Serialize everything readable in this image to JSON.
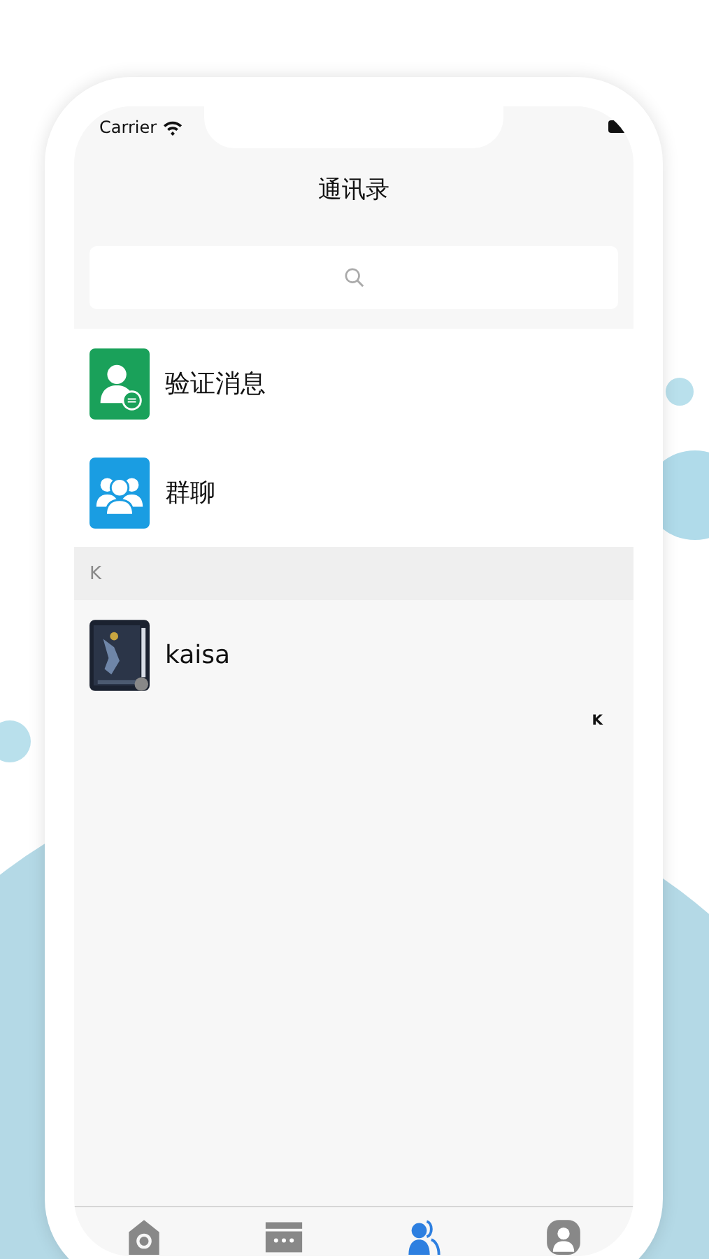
{
  "status_bar": {
    "carrier": "Carrier"
  },
  "nav": {
    "title": "通讯录"
  },
  "entries": [
    {
      "kind": "verify",
      "label": "验证消息"
    },
    {
      "kind": "group",
      "label": "群聊"
    }
  ],
  "sections": [
    {
      "letter": "K",
      "contacts": [
        {
          "name": "kaisa"
        }
      ]
    }
  ],
  "index_bar": [
    "K"
  ],
  "tab_bar": [
    {
      "kind": "home",
      "selected": false
    },
    {
      "kind": "chat",
      "selected": false
    },
    {
      "kind": "contacts",
      "selected": true
    },
    {
      "kind": "me",
      "selected": false
    }
  ]
}
